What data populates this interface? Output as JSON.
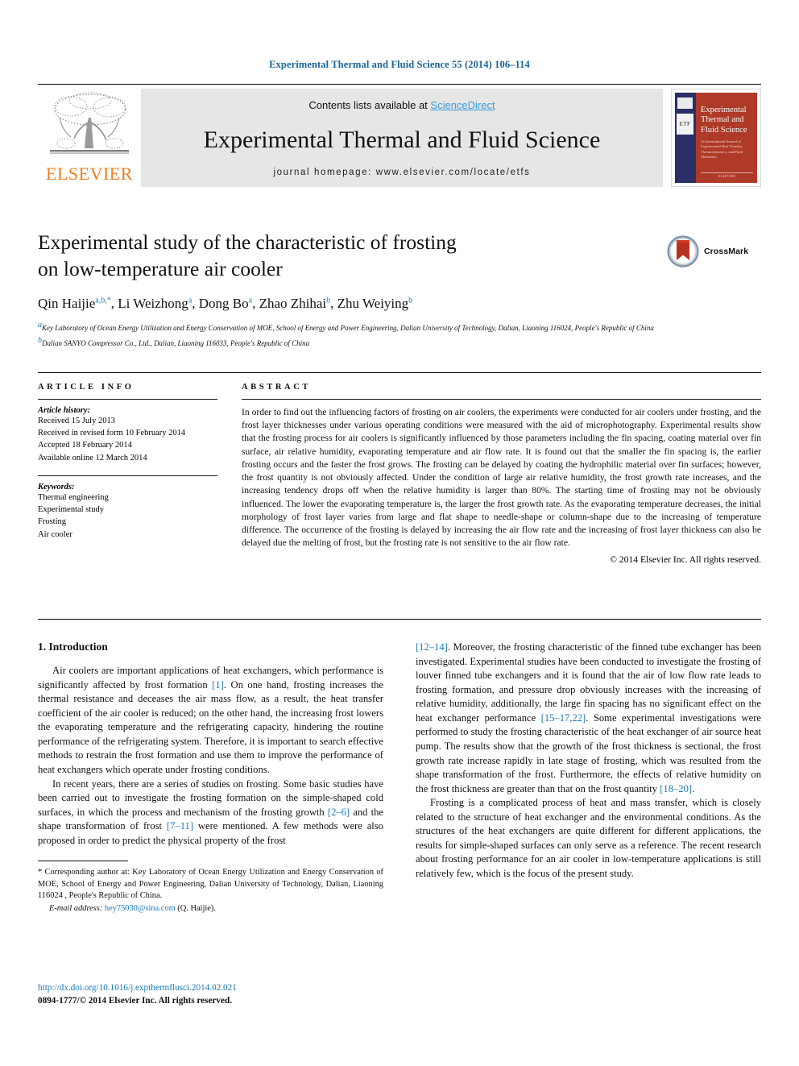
{
  "running_head": "Experimental Thermal and Fluid Science 55 (2014) 106–114",
  "masthead": {
    "contents_prefix": "Contents lists available at ",
    "sciencedirect": "ScienceDirect",
    "journal_title": "Experimental Thermal and Fluid Science",
    "homepage": "journal homepage: www.elsevier.com/locate/etfs",
    "publisher_wordmark": "ELSEVIER",
    "cover": {
      "title": "Experimental Thermal and Fluid Science",
      "subtitle": "An International Journal of Experimental Heat Transfer, Thermodynamics, and Fluid Mechanics",
      "spine_logo": "ETF",
      "footer": "ELSEVIER"
    }
  },
  "article": {
    "title_line1": "Experimental study of the characteristic of frosting",
    "title_line2": "on low-temperature air cooler",
    "authors": [
      {
        "name": "Qin Haijie",
        "sup": "a,b,*"
      },
      {
        "name": "Li Weizhong",
        "sup": "a"
      },
      {
        "name": "Dong Bo",
        "sup": "a"
      },
      {
        "name": "Zhao Zhihai",
        "sup": "b"
      },
      {
        "name": "Zhu Weiying",
        "sup": "b"
      }
    ],
    "affiliations": [
      {
        "sup": "a",
        "text": "Key Laboratory of Ocean Energy Utilization and Energy Conservation of MOE, School of Energy and Power Engineering, Dalian University of Technology, Dalian, Liaoning 116024, People's Republic of China"
      },
      {
        "sup": "b",
        "text": "Dalian SANYO Compressor Co., Ltd., Dalian, Liaoning 116033, People's Republic of China"
      }
    ],
    "crossmark_label": "CrossMark"
  },
  "article_info": {
    "heading": "ARTICLE INFO",
    "history_label": "Article history:",
    "history": [
      "Received 15 July 2013",
      "Received in revised form 10 February 2014",
      "Accepted 18 February 2014",
      "Available online 12 March 2014"
    ],
    "keywords_label": "Keywords:",
    "keywords": [
      "Thermal engineering",
      "Experimental study",
      "Frosting",
      "Air cooler"
    ]
  },
  "abstract": {
    "heading": "ABSTRACT",
    "text": "In order to find out the influencing factors of frosting on air coolers, the experiments were conducted for air coolers under frosting, and the frost layer thicknesses under various operating conditions were measured with the aid of microphotography. Experimental results show that the frosting process for air coolers is significantly influenced by those parameters including the fin spacing, coating material over fin surface, air relative humidity, evaporating temperature and air flow rate. It is found out that the smaller the fin spacing is, the earlier frosting occurs and the faster the frost grows. The frosting can be delayed by coating the hydrophilic material over fin surfaces; however, the frost quantity is not obviously affected. Under the condition of large air relative humidity, the frost growth rate increases, and the increasing tendency drops off when the relative humidity is larger than 80%. The starting time of frosting may not be obviously influenced. The lower the evaporating temperature is, the larger the frost growth rate. As the evaporating temperature decreases, the initial morphology of frost layer varies from large and flat shape to needle-shape or column-shape due to the increasing of temperature difference. The occurrence of the frosting is delayed by increasing the air flow rate and the increasing of frost layer thickness can also be delayed due the melting of frost, but the frosting rate is not sensitive to the air flow rate.",
    "copyright": "© 2014 Elsevier Inc. All rights reserved."
  },
  "introduction": {
    "heading": "1. Introduction",
    "left_p1_a": "Air coolers are important applications of heat exchangers, which performance is significantly affected by frost formation ",
    "left_p1_ref1": "[1]",
    "left_p1_b": ". On one hand, frosting increases the thermal resistance and deceases the air mass flow, as a result, the heat transfer coefficient of the air cooler is reduced; on the other hand, the increasing frost lowers the evaporating temperature and the refrigerating capacity, hindering the routine performance of the refrigerating system. Therefore, it is important to search effective methods to restrain the frost formation and use them to improve the performance of heat exchangers which operate under frosting conditions.",
    "left_p2_a": "In recent years, there are a series of studies on frosting. Some basic studies have been carried out to investigate the frosting formation on the simple-shaped cold surfaces, in which the process and mechanism of the frosting growth ",
    "left_p2_ref1": "[2–6]",
    "left_p2_b": " and the shape transformation of frost ",
    "left_p2_ref2": "[7–11]",
    "left_p2_c": " were mentioned. A few methods were also proposed in order to predict the physical property of the frost",
    "right_p1_ref1": "[12–14]",
    "right_p1_a": ". Moreover, the frosting characteristic of the finned tube exchanger has been investigated. Experimental studies have been conducted to investigate the frosting of louver finned tube exchangers and it is found that the air of low flow rate leads to frosting formation, and pressure drop obviously increases with the increasing of relative humidity, additionally, the large fin spacing has no significant effect on the heat exchanger performance ",
    "right_p1_ref2": "[15–17,22]",
    "right_p1_b": ". Some experimental investigations were performed to study the frosting characteristic of the heat exchanger of air source heat pump. The results show that the growth of the frost thickness is sectional, the frost growth rate increase rapidly in late stage of frosting, which was resulted from the shape transformation of the frost. Furthermore, the effects of relative humidity on the frost thickness are greater than that on the frost quantity ",
    "right_p1_ref3": "[18–20]",
    "right_p1_c": ".",
    "right_p2": "Frosting is a complicated process of heat and mass transfer, which is closely related to the structure of heat exchanger and the environmental conditions. As the structures of the heat exchangers are quite different for different applications, the results for simple-shaped surfaces can only serve as a reference. The recent research about frosting performance for an air cooler in low-temperature applications is still relatively few, which is the focus of the present study."
  },
  "footnote": {
    "marker": "*",
    "text": "Corresponding author at: Key Laboratory of Ocean Energy Utilization and Energy Conservation of MOE, School of Energy and Power Engineering, Dalian University of Technology, Dalian, Liaoning 116024 , People's Republic of China.",
    "email_label": "E-mail address:",
    "email": "hey75030@sina.com",
    "email_owner": "(Q. Haijie)."
  },
  "page_footer": {
    "doi": "http://dx.doi.org/10.1016/j.expthermflusci.2014.02.021",
    "issn_copyright": "0894-1777/© 2014 Elsevier Inc. All rights reserved."
  },
  "colors": {
    "link_blue": "#1a79b8",
    "header_blue": "#1a6496",
    "elsevier_orange": "#ef7d22",
    "band_gray": "#e6e6e6",
    "cover_red": "#b03a28",
    "cover_navy": "#2b2f66"
  }
}
